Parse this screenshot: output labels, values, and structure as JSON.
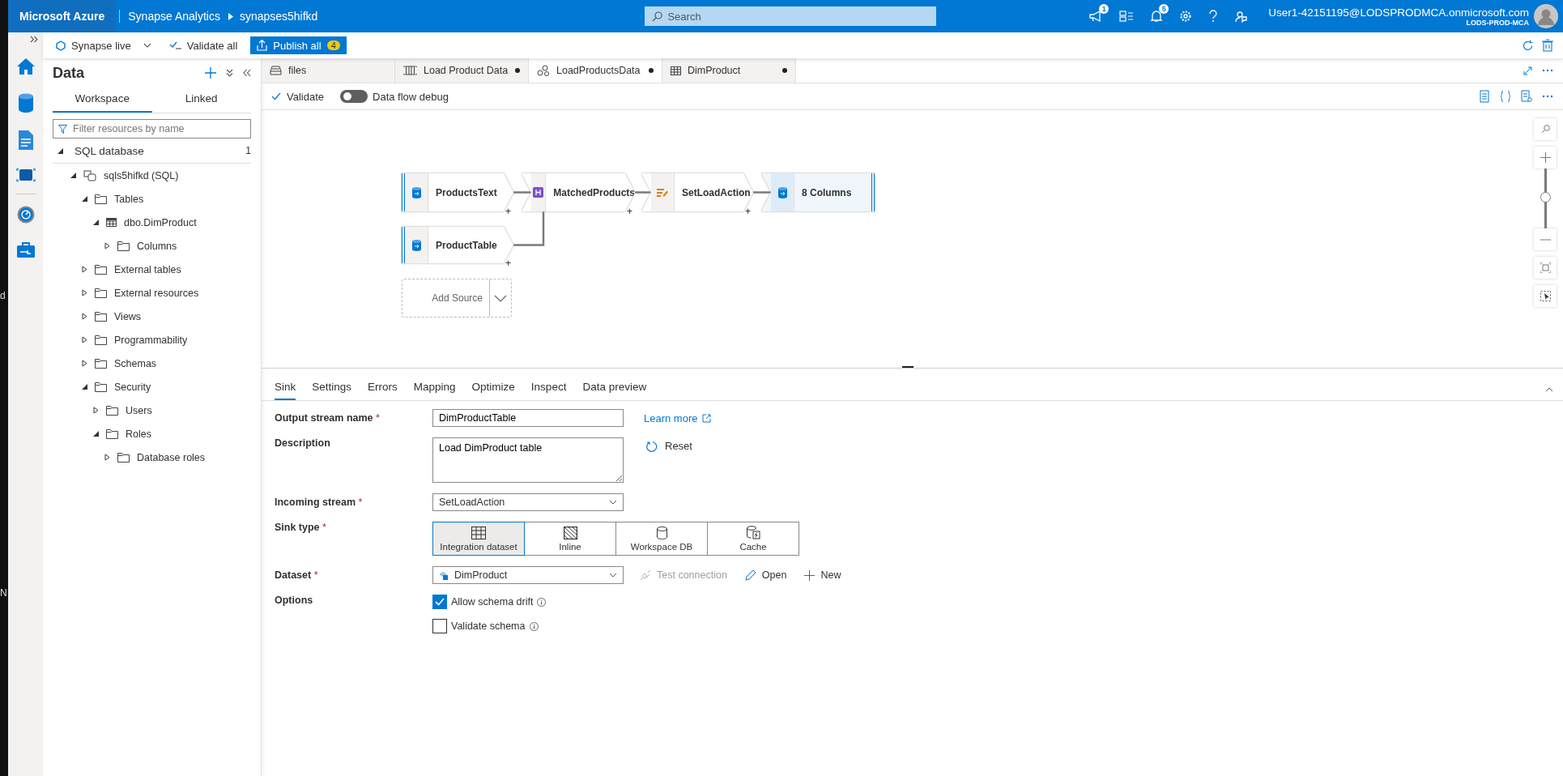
{
  "behind_window": {
    "texts": [
      "d",
      "N"
    ]
  },
  "header": {
    "brand": "Microsoft Azure",
    "service": "Synapse Analytics",
    "workspace": "synapses5hifkd",
    "search": {
      "placeholder": "Search"
    },
    "icons": [
      {
        "kind": "megaphone",
        "count": "1"
      },
      {
        "kind": "directory"
      },
      {
        "kind": "bell",
        "count": "5"
      },
      {
        "kind": "settings"
      },
      {
        "kind": "help"
      },
      {
        "kind": "feedback"
      }
    ],
    "user": {
      "name": "User1-42151195@LODSPRODMCA.onmicrosoft.com",
      "tenant": "LODS-PROD-MCA"
    }
  },
  "toolbar": {
    "mode": "Synapse live",
    "validate_all": "Validate all",
    "publish": {
      "label": "Publish all",
      "count": "4"
    }
  },
  "rail": {
    "items": [
      {
        "kind": "home"
      },
      {
        "kind": "data"
      },
      {
        "kind": "develop"
      },
      {
        "kind": "integrate"
      },
      {
        "kind": "monitor"
      },
      {
        "kind": "manage"
      }
    ]
  },
  "sidebar": {
    "title": "Data",
    "tabs": [
      {
        "label": "Workspace",
        "selected": true
      },
      {
        "label": "Linked",
        "selected": false
      }
    ],
    "filter": {
      "placeholder": "Filter resources by name"
    },
    "section": {
      "label": "SQL database",
      "count": "1",
      "expanded": true
    },
    "tree": [
      {
        "label": "sqls5hifkd (SQL)",
        "kind": "server",
        "expanded": true,
        "children": [
          {
            "label": "Tables",
            "kind": "folder",
            "expanded": true,
            "children": [
              {
                "label": "dbo.DimProduct",
                "kind": "table",
                "expanded": true,
                "children": [
                  {
                    "label": "Columns",
                    "kind": "folder",
                    "expanded": false
                  }
                ]
              }
            ]
          },
          {
            "label": "External tables",
            "kind": "folder",
            "expanded": false
          },
          {
            "label": "External resources",
            "kind": "folder",
            "expanded": false
          },
          {
            "label": "Views",
            "kind": "folder",
            "expanded": false
          },
          {
            "label": "Programmability",
            "kind": "folder",
            "expanded": false
          },
          {
            "label": "Schemas",
            "kind": "folder",
            "expanded": false
          },
          {
            "label": "Security",
            "kind": "folder",
            "expanded": true,
            "children": [
              {
                "label": "Users",
                "kind": "folder",
                "expanded": false
              },
              {
                "label": "Roles",
                "kind": "folder",
                "expanded": true,
                "children": [
                  {
                    "label": "Database roles",
                    "kind": "folder",
                    "expanded": false
                  }
                ]
              }
            ]
          }
        ]
      }
    ]
  },
  "doc_tabs": [
    {
      "label": "files",
      "kind": "files",
      "modified": false,
      "selected": false
    },
    {
      "label": "Load Product Data",
      "kind": "pipeline",
      "modified": true,
      "selected": false
    },
    {
      "label": "LoadProductsData",
      "kind": "dataflow",
      "modified": true,
      "selected": true
    },
    {
      "label": "DimProduct",
      "kind": "table",
      "modified": true,
      "selected": false
    }
  ],
  "editor_toolbar": {
    "validate": "Validate",
    "debug": {
      "label": "Data flow debug",
      "on": false
    }
  },
  "canvas": {
    "nodes": [
      {
        "kind": "source",
        "label": "ProductsText",
        "plus": "+"
      },
      {
        "kind": "join",
        "label": "MatchedProducts",
        "plus": "+"
      },
      {
        "kind": "alter",
        "label": "SetLoadAction",
        "plus": "+"
      },
      {
        "kind": "sink",
        "label": "8 Columns"
      },
      {
        "kind": "source",
        "label": "ProductTable",
        "plus": "+"
      }
    ],
    "add_source": "Add Source",
    "zoom": {
      "level": 0.53
    }
  },
  "panel": {
    "tabs": [
      {
        "label": "Sink",
        "selected": true
      },
      {
        "label": "Settings",
        "selected": false
      },
      {
        "label": "Errors",
        "selected": false
      },
      {
        "label": "Mapping",
        "selected": false
      },
      {
        "label": "Optimize",
        "selected": false
      },
      {
        "label": "Inspect",
        "selected": false
      },
      {
        "label": "Data preview",
        "selected": false
      }
    ],
    "output_stream": {
      "label": "Output stream name",
      "mark": "*",
      "value": "DimProductTable",
      "link": "Learn more"
    },
    "description": {
      "label": "Description",
      "value": "Load DimProduct table",
      "action": "Reset"
    },
    "incoming": {
      "label": "Incoming stream",
      "mark": "*",
      "value": "SetLoadAction"
    },
    "sink_type": {
      "label": "Sink type",
      "mark": "*",
      "options": [
        {
          "label": "Integration dataset",
          "kind": "grid",
          "selected": true
        },
        {
          "label": "Inline",
          "kind": "hatch",
          "selected": false
        },
        {
          "label": "Workspace DB",
          "kind": "db",
          "selected": false
        },
        {
          "label": "Cache",
          "kind": "cache",
          "selected": false
        }
      ]
    },
    "dataset": {
      "label": "Dataset",
      "mark": "*",
      "value": "DimProduct",
      "actions": [
        {
          "label": "Test connection",
          "kind": "test",
          "disabled": true
        },
        {
          "label": "Open",
          "kind": "edit",
          "disabled": false
        },
        {
          "label": "New",
          "kind": "add",
          "disabled": false
        }
      ]
    },
    "options": {
      "label": "Options",
      "checkboxes": [
        {
          "label": "Allow schema drift",
          "checked": true
        },
        {
          "label": "Validate schema",
          "checked": false
        }
      ]
    }
  }
}
